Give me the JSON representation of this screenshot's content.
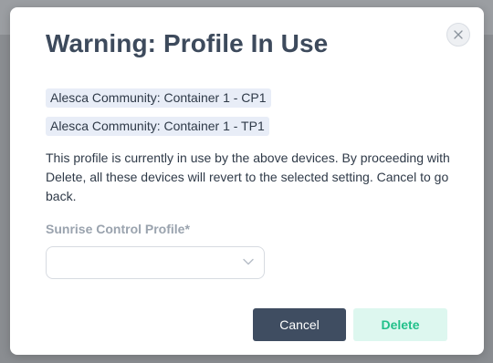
{
  "dialog": {
    "title": "Warning: Profile In Use",
    "close_icon": "close-icon",
    "devices": [
      "Alesca Community: Container 1 - CP1",
      "Alesca Community: Container 1 - TP1"
    ],
    "message": "This profile is currently in use by the above devices. By proceeding with Delete, all these devices will revert to the selected setting. Cancel to go back.",
    "field": {
      "label": "Sunrise Control Profile*",
      "value": "",
      "icon": "chevron-down-icon"
    },
    "buttons": {
      "cancel_label": "Cancel",
      "delete_label": "Delete"
    }
  },
  "colors": {
    "title": "#3d4a5c",
    "cancel_bg": "#3f4d61",
    "delete_bg": "#ddf7ef",
    "delete_text": "#22c08a",
    "tag_bg": "#e8edf7",
    "label": "#9aa3ae"
  }
}
